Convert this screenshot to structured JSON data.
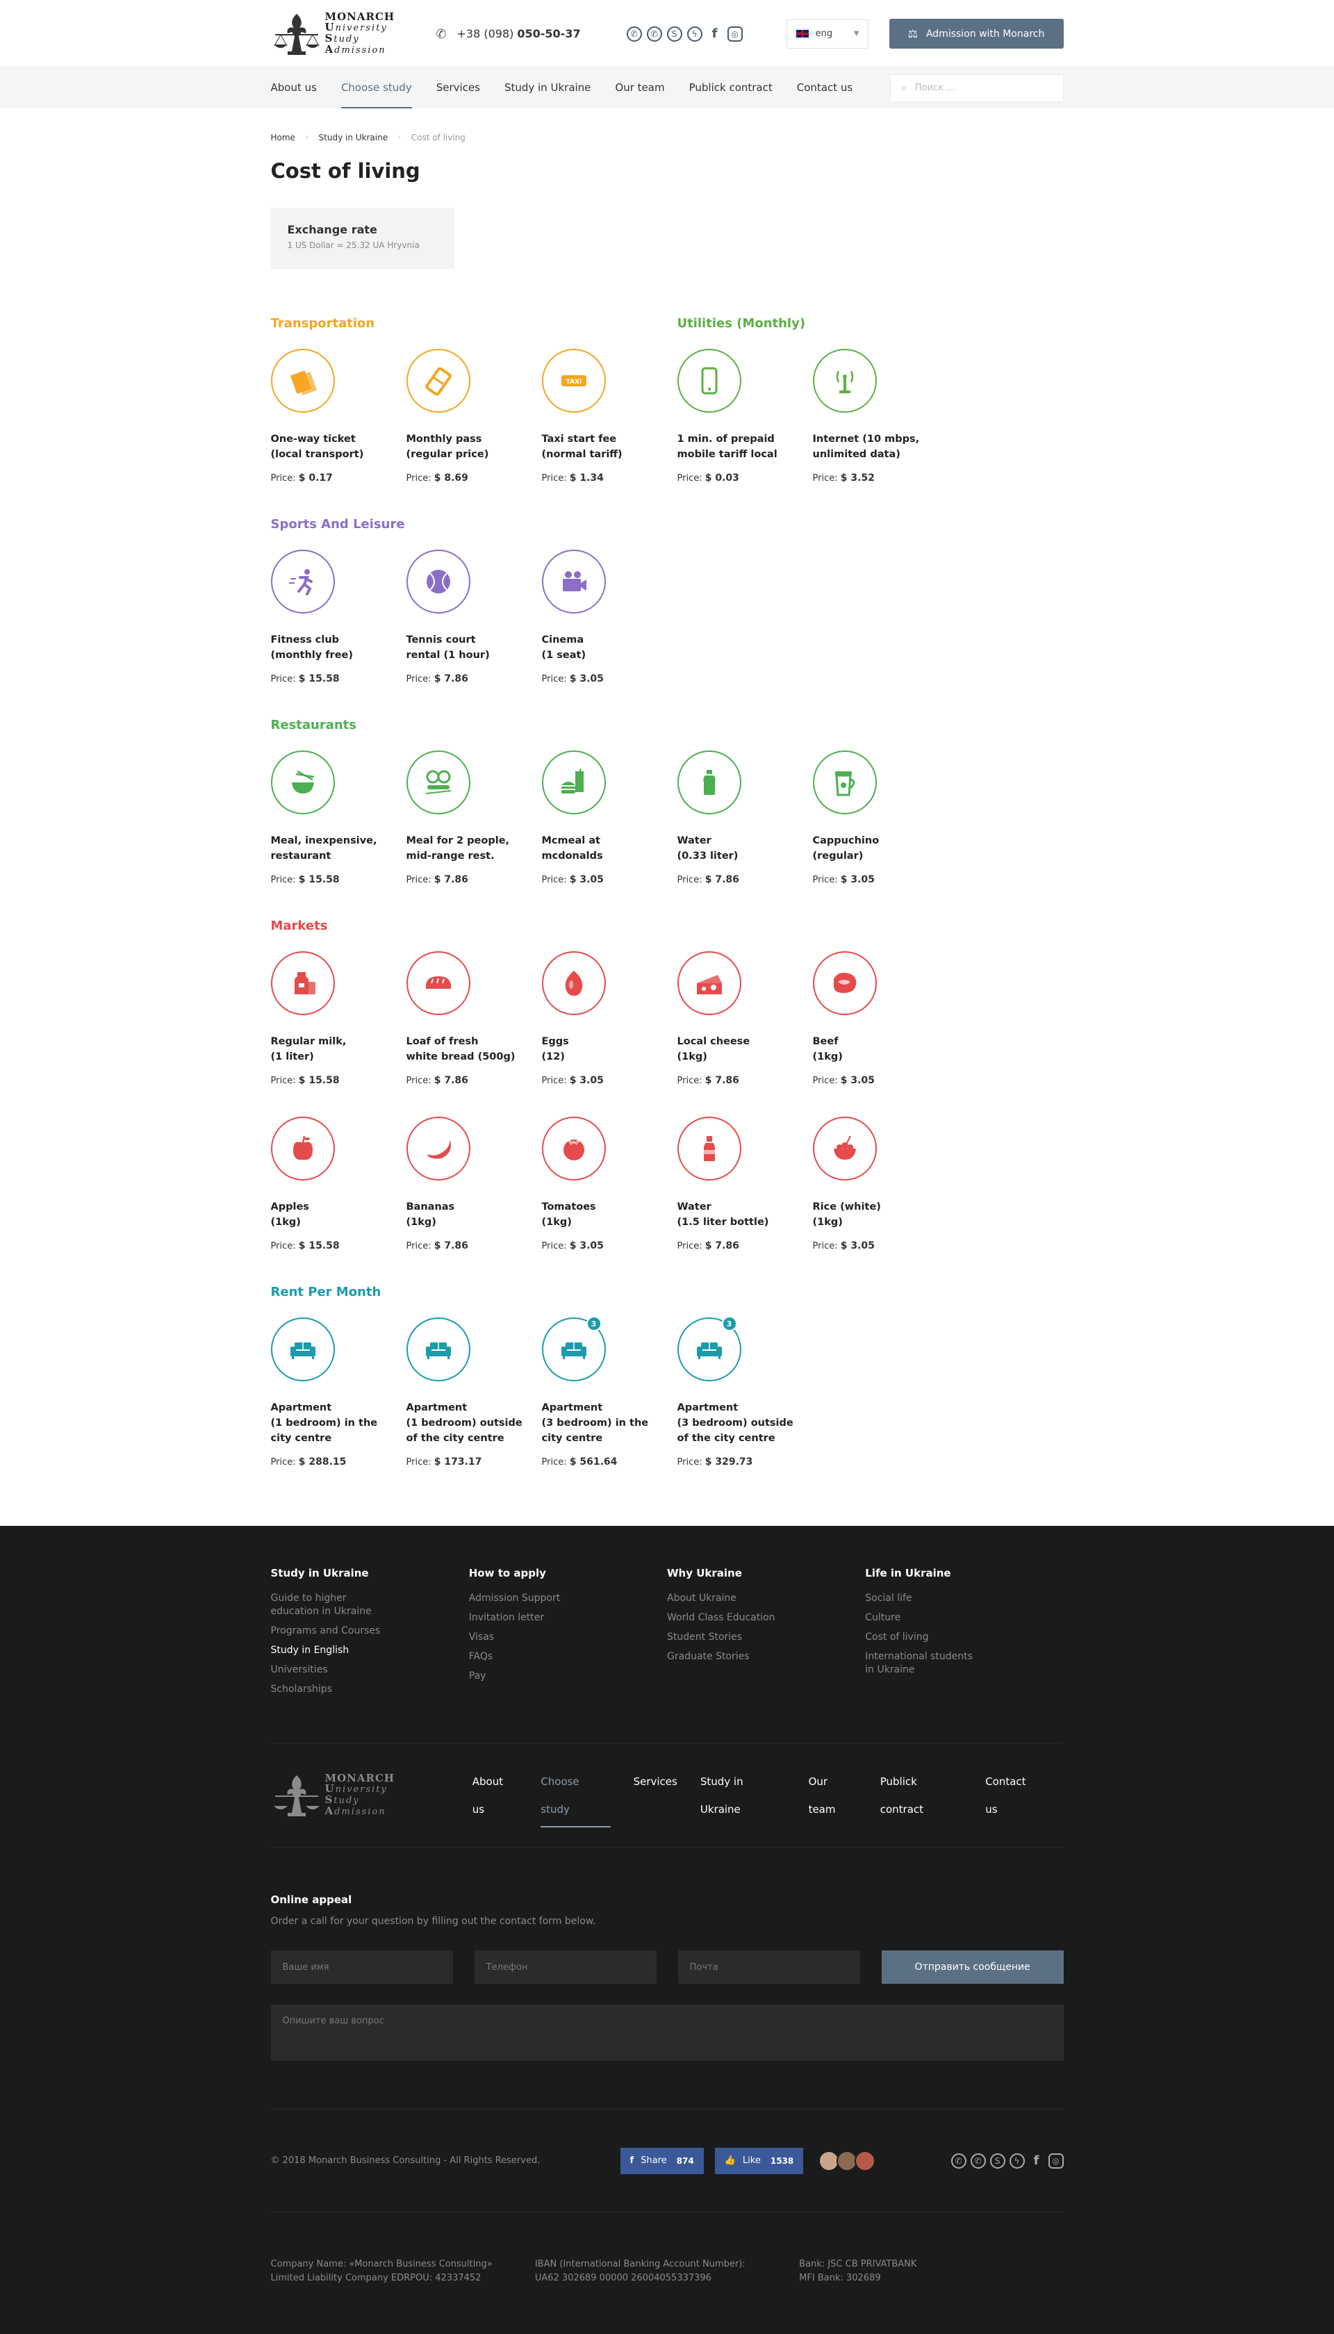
{
  "header": {
    "logo_lines": [
      "MONARCH",
      "U",
      "niversity",
      "S",
      "tudy",
      "A",
      "dmission"
    ],
    "phone_prefix": "+38 (098)",
    "phone_number": "050-50-37",
    "socials": [
      "whatsapp-icon",
      "viber-icon",
      "skype-icon",
      "messenger-icon",
      "facebook-icon",
      "instagram-icon"
    ],
    "lang": "eng",
    "admission_button": "Admission with Monarch",
    "nav": [
      "About us",
      "Choose study",
      "Services",
      "Study in Ukraine",
      "Our team",
      "Publick contract",
      "Contact us"
    ],
    "nav_active": 1,
    "search_placeholder": "Поиск ..."
  },
  "breadcrumb": [
    "Home",
    "Study in Ukraine",
    "Cost of living"
  ],
  "title": "Cost of living",
  "exchange": {
    "title": "Exchange rate",
    "value": "1 US Dollar = 25.32 UA Hryvnia"
  },
  "price_label": "Price:",
  "groups": {
    "transportation": {
      "title": "Transportation",
      "color": "#f5a623",
      "items": [
        {
          "name": "One-way ticket\n(local transport)",
          "price": "$ 0.17",
          "icon": "tickets-icon"
        },
        {
          "name": "Monthly pass\n(regular price)",
          "price": "$ 8.69",
          "icon": "ticket-icon"
        },
        {
          "name": "Taxi start fee\n(normal tariff)",
          "price": "$ 1.34",
          "icon": "taxi-icon"
        }
      ]
    },
    "utilities": {
      "title": "Utilities (Monthly)",
      "color": "#5cb043",
      "items": [
        {
          "name": "1 min. of prepaid\nmobile tariff local",
          "price": "$ 0.03",
          "icon": "mobile-phone-icon"
        },
        {
          "name": "Internet (10 mbps,\nunlimited data)",
          "price": "$  3.52",
          "icon": "antenna-icon"
        }
      ]
    },
    "sports": {
      "title": "Sports And Leisure",
      "color": "#8b6ec8",
      "items": [
        {
          "name": "Fitness club\n(monthly free)",
          "price": "$ 15.58",
          "icon": "running-icon"
        },
        {
          "name": "Tennis court\nrental (1 hour)",
          "price": "$ 7.86",
          "icon": "tennis-ball-icon"
        },
        {
          "name": "Cinema\n(1 seat)",
          "price": "$ 3.05",
          "icon": "video-camera-icon"
        }
      ]
    },
    "restaurants": {
      "title": "Restaurants",
      "color": "#4caf50",
      "items": [
        {
          "name": "Meal, inexpensive,\nrestaurant",
          "price": "$ 15.58",
          "icon": "noodle-bowl-icon"
        },
        {
          "name": "Meal for 2 people,\nmid-range rest.",
          "price": "$ 7.86",
          "icon": "sushi-icon"
        },
        {
          "name": "Mcmeal at\nmcdonalds",
          "price": "$ 3.05",
          "icon": "fast-food-icon"
        },
        {
          "name": "Water\n(0.33 liter)",
          "price": "$ 7.86",
          "icon": "water-bottle-icon"
        },
        {
          "name": "Cappuchino\n(regular)",
          "price": "$ 3.05",
          "icon": "coffee-cup-icon"
        }
      ]
    },
    "markets": {
      "title": "Markets",
      "color": "#e54b4b",
      "items": [
        {
          "name": "Regular milk,\n(1 liter)",
          "price": "$ 15.58",
          "icon": "milk-icon"
        },
        {
          "name": "Loaf of fresh\nwhite bread (500g)",
          "price": "$ 7.86",
          "icon": "bread-icon"
        },
        {
          "name": "Eggs\n(12)",
          "price": "$ 3.05",
          "icon": "egg-icon"
        },
        {
          "name": "Local cheese\n(1kg)",
          "price": "$ 7.86",
          "icon": "cheese-icon"
        },
        {
          "name": "Beef\n(1kg)",
          "price": "$ 3.05",
          "icon": "steak-icon"
        },
        {
          "name": "Apples\n(1kg)",
          "price": "$ 15.58",
          "icon": "apple-icon"
        },
        {
          "name": "Bananas\n(1kg)",
          "price": "$ 7.86",
          "icon": "banana-icon"
        },
        {
          "name": "Tomatoes\n(1kg)",
          "price": "$ 3.05",
          "icon": "tomato-icon"
        },
        {
          "name": "Water\n(1.5 liter bottle)",
          "price": "$ 7.86",
          "icon": "bottle-icon"
        },
        {
          "name": "Rice (white)\n(1kg)",
          "price": "$ 3.05",
          "icon": "rice-bowl-icon"
        }
      ]
    },
    "rent": {
      "title": "Rent Per Month",
      "color": "#1a9cad",
      "items": [
        {
          "name": "Apartment\n(1 bedroom) in the\ncity centre",
          "price": "$ 288.15",
          "icon": "sofa-icon",
          "badge": ""
        },
        {
          "name": "Apartment\n(1 bedroom) outside\nof the city centre",
          "price": "$ 173.17",
          "icon": "sofa-icon",
          "badge": ""
        },
        {
          "name": "Apartment\n(3 bedroom) in the\ncity centre",
          "price": "$ 561.64",
          "icon": "sofa-icon",
          "badge": "3"
        },
        {
          "name": "Apartment\n(3 bedroom) outside\nof the city centre",
          "price": "$ 329.73",
          "icon": "sofa-icon",
          "badge": "3"
        }
      ]
    }
  },
  "footer": {
    "columns": [
      {
        "title": "Study in Ukraine",
        "links": [
          "Guide to higher\neducation in Ukraine",
          "Programs and Courses",
          "Study in English",
          "Universities",
          "Scholarships"
        ],
        "highlight": 2
      },
      {
        "title": "How to apply",
        "links": [
          "Admission Support",
          "Invitation letter",
          "Visas",
          "FAQs",
          "Pay"
        ]
      },
      {
        "title": "Why Ukraine",
        "links": [
          "About Ukraine",
          "World Class Education",
          "Student Stories",
          "Graduate Stories"
        ]
      },
      {
        "title": "Life in Ukraine",
        "links": [
          "Social life",
          "Culture",
          "Cost of living",
          "International students\nin Ukraine"
        ]
      }
    ],
    "nav": [
      "About us",
      "Choose study",
      "Services",
      "Study in Ukraine",
      "Our team",
      "Publick contract",
      "Contact us"
    ],
    "appeal": {
      "title": "Online appeal",
      "text": "Order a call for your question by filling out the contact form below.",
      "name": "Ваше имя",
      "phone": "Телефон",
      "email": "Почта",
      "submit": "Отправить сообщение",
      "question": "Опишите ваш вопрос"
    },
    "copyright": "© 2018 Monarch Business Consulting - All Rights Reserved.",
    "share": {
      "label": "Share",
      "count": "874"
    },
    "like": {
      "label": "Like",
      "count": "1538"
    },
    "bank": [
      "Company Name: «Monarch Business Consulting»\nLimited Liability Company EDRPOU: 42337452",
      "IBAN (International Banking Account Number):\nUA62 302689 00000 26004055337396",
      "Bank: JSC CB PRIVATBANK\nMFI Bank: 302689"
    ]
  }
}
